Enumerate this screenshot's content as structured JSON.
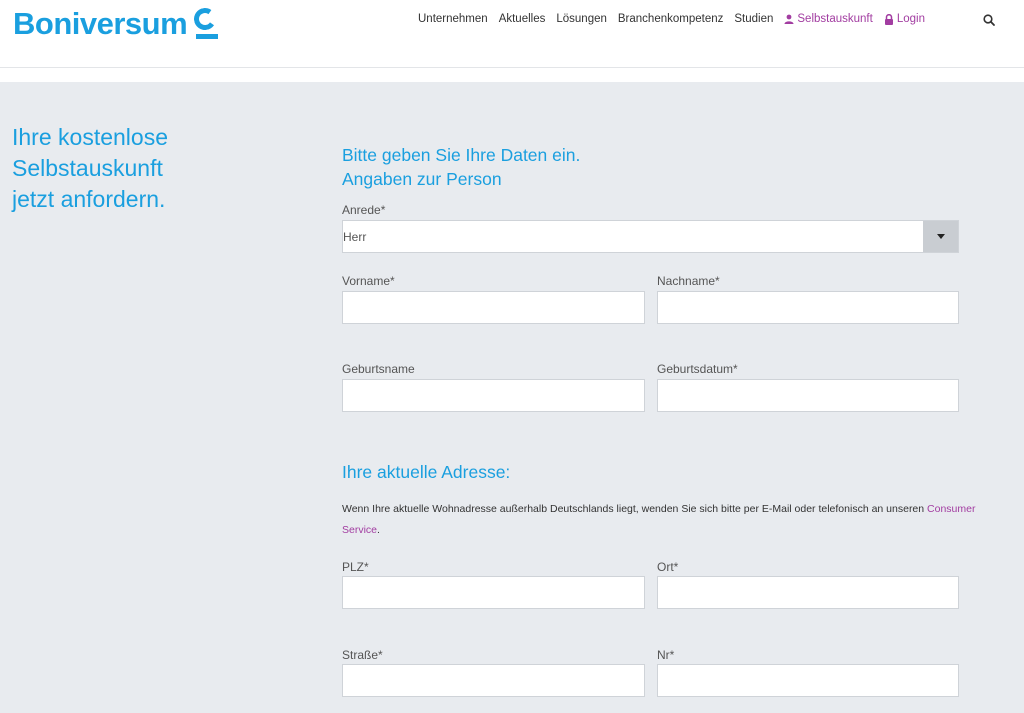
{
  "brand": {
    "name": "Boniversum",
    "color": "#1a9fdf",
    "accent": "#a23da1"
  },
  "nav": {
    "items": [
      "Unternehmen",
      "Aktuelles",
      "Lösungen",
      "Branchenkompetenz",
      "Studien"
    ],
    "self_service": "Selbstauskunft",
    "login": "Login",
    "search_icon": "search-icon"
  },
  "hero": {
    "line1": "Ihre kostenlose",
    "line2": "Selbstauskunft",
    "line3": "jetzt anfordern."
  },
  "form": {
    "intro": "Bitte geben Sie Ihre Daten ein.",
    "person_heading": "Angaben zur Person",
    "anrede_label": "Anrede*",
    "anrede_value": "Herr",
    "vorname_label": "Vorname*",
    "nachname_label": "Nachname*",
    "geburtsname_label": "Geburtsname",
    "geburtsdatum_label": "Geburtsdatum*",
    "address_heading": "Ihre aktuelle Adresse:",
    "address_note": "Wenn Ihre aktuelle Wohnadresse außerhalb Deutschlands liegt, wenden Sie sich bitte per E-Mail oder telefonisch an unseren",
    "address_note_link": "Consumer Service",
    "plz_label": "PLZ*",
    "ort_label": "Ort*",
    "strasse_label": "Straße*",
    "nr_label": "Nr*"
  }
}
